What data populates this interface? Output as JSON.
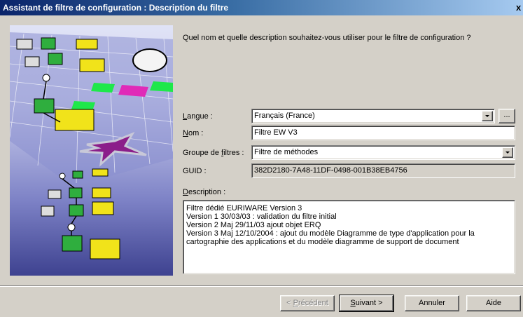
{
  "window": {
    "title": "Assistant de filtre de configuration : Description du filtre",
    "close_glyph": "x"
  },
  "main": {
    "prompt": "Quel nom et quelle description souhaitez-vous utiliser pour le filtre de configuration ?"
  },
  "form": {
    "langue": {
      "label_access": "L",
      "label_rest": "angue :",
      "value": "Français (France)",
      "browse_label": "..."
    },
    "nom": {
      "label_access": "N",
      "label_rest": "om :",
      "value": "Filtre EW V3"
    },
    "groupe": {
      "label_prefix": "Groupe de ",
      "label_access": "f",
      "label_rest": "iltres :",
      "value": "Filtre de méthodes"
    },
    "guid": {
      "label": "GUID :",
      "value": "382D2180-7A48-11DF-0498-001B38EB4756"
    },
    "description": {
      "label_access": "D",
      "label_rest": "escription :",
      "lines": [
        "Filtre dédié EURIWARE Version 3",
        "Version 1 30/03/03 : validation du filtre initial",
        "Version 2 Maj 29/11/03 ajout objet ERQ",
        "Version 3 Maj 12/10/2004 : ajout du modèle Diagramme de type d'application pour la",
        "cartographie des applications et du modèle diagramme de support de document"
      ]
    }
  },
  "footer": {
    "precedent_prefix": "< ",
    "precedent_access": "P",
    "precedent_rest": "récédent",
    "suivant_access": "S",
    "suivant_rest": "uivant >",
    "annuler": "Annuler",
    "aide": "Aide"
  },
  "colors": {
    "title_start": "#0a246a",
    "title_end": "#a6caf0",
    "dialog_bg": "#d4d0c8"
  }
}
